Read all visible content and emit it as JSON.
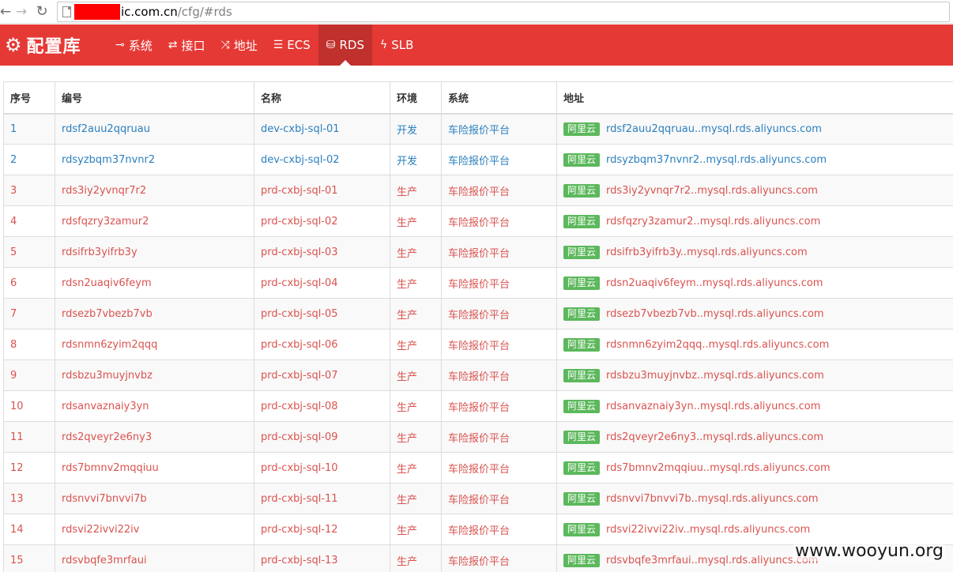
{
  "browser": {
    "url_host": "ic.com.cn",
    "url_path": "/cfg/#rds"
  },
  "brand": {
    "icon": "gears-icon",
    "title": "配置库"
  },
  "nav": [
    {
      "label": "系统",
      "icon": "plug-icon",
      "glyph": "⊸"
    },
    {
      "label": "接口",
      "icon": "exchange-icon",
      "glyph": "⇄"
    },
    {
      "label": "地址",
      "icon": "random-icon",
      "glyph": "⤨"
    },
    {
      "label": "ECS",
      "icon": "list-icon",
      "glyph": "☰"
    },
    {
      "label": "RDS",
      "icon": "database-icon",
      "glyph": "⛁",
      "active": true
    },
    {
      "label": "SLB",
      "icon": "bolt-icon",
      "glyph": "ϟ"
    }
  ],
  "table": {
    "headers": [
      "序号",
      "编号",
      "名称",
      "环境",
      "系统",
      "地址"
    ],
    "badge_label": "阿里云",
    "rows": [
      {
        "index": "1",
        "id": "rdsf2auu2qqruau",
        "name": "dev-cxbj-sql-01",
        "env": "开发",
        "system": "车险报价平台",
        "address": "rdsf2auu2qqruau..mysql.rds.aliyuncs.com",
        "kind": "dev"
      },
      {
        "index": "2",
        "id": "rdsyzbqm37nvnr2",
        "name": "dev-cxbj-sql-02",
        "env": "开发",
        "system": "车险报价平台",
        "address": "rdsyzbqm37nvnr2..mysql.rds.aliyuncs.com",
        "kind": "dev"
      },
      {
        "index": "3",
        "id": "rds3iy2yvnqr7r2",
        "name": "prd-cxbj-sql-01",
        "env": "生产",
        "system": "车险报价平台",
        "address": "rds3iy2yvnqr7r2..mysql.rds.aliyuncs.com",
        "kind": "prd"
      },
      {
        "index": "4",
        "id": "rdsfqzry3zamur2",
        "name": "prd-cxbj-sql-02",
        "env": "生产",
        "system": "车险报价平台",
        "address": "rdsfqzry3zamur2..mysql.rds.aliyuncs.com",
        "kind": "prd"
      },
      {
        "index": "5",
        "id": "rdsifrb3yifrb3y",
        "name": "prd-cxbj-sql-03",
        "env": "生产",
        "system": "车险报价平台",
        "address": "rdsifrb3yifrb3y..mysql.rds.aliyuncs.com",
        "kind": "prd"
      },
      {
        "index": "6",
        "id": "rdsn2uaqiv6feym",
        "name": "prd-cxbj-sql-04",
        "env": "生产",
        "system": "车险报价平台",
        "address": "rdsn2uaqiv6feym..mysql.rds.aliyuncs.com",
        "kind": "prd"
      },
      {
        "index": "7",
        "id": "rdsezb7vbezb7vb",
        "name": "prd-cxbj-sql-05",
        "env": "生产",
        "system": "车险报价平台",
        "address": "rdsezb7vbezb7vb..mysql.rds.aliyuncs.com",
        "kind": "prd"
      },
      {
        "index": "8",
        "id": "rdsnmn6zyim2qqq",
        "name": "prd-cxbj-sql-06",
        "env": "生产",
        "system": "车险报价平台",
        "address": "rdsnmn6zyim2qqq..mysql.rds.aliyuncs.com",
        "kind": "prd"
      },
      {
        "index": "9",
        "id": "rdsbzu3muyjnvbz",
        "name": "prd-cxbj-sql-07",
        "env": "生产",
        "system": "车险报价平台",
        "address": "rdsbzu3muyjnvbz..mysql.rds.aliyuncs.com",
        "kind": "prd"
      },
      {
        "index": "10",
        "id": "rdsanvaznaiy3yn",
        "name": "prd-cxbj-sql-08",
        "env": "生产",
        "system": "车险报价平台",
        "address": "rdsanvaznaiy3yn..mysql.rds.aliyuncs.com",
        "kind": "prd"
      },
      {
        "index": "11",
        "id": "rds2qveyr2e6ny3",
        "name": "prd-cxbj-sql-09",
        "env": "生产",
        "system": "车险报价平台",
        "address": "rds2qveyr2e6ny3..mysql.rds.aliyuncs.com",
        "kind": "prd"
      },
      {
        "index": "12",
        "id": "rds7bmnv2mqqiuu",
        "name": "prd-cxbj-sql-10",
        "env": "生产",
        "system": "车险报价平台",
        "address": "rds7bmnv2mqqiuu..mysql.rds.aliyuncs.com",
        "kind": "prd"
      },
      {
        "index": "13",
        "id": "rdsnvvi7bnvvi7b",
        "name": "prd-cxbj-sql-11",
        "env": "生产",
        "system": "车险报价平台",
        "address": "rdsnvvi7bnvvi7b..mysql.rds.aliyuncs.com",
        "kind": "prd"
      },
      {
        "index": "14",
        "id": "rdsvi22ivvi22iv",
        "name": "prd-cxbj-sql-12",
        "env": "生产",
        "system": "车险报价平台",
        "address": "rdsvi22ivvi22iv..mysql.rds.aliyuncs.com",
        "kind": "prd"
      },
      {
        "index": "15",
        "id": "rdsvbqfe3mrfaui",
        "name": "prd-cxbj-sql-13",
        "env": "生产",
        "system": "车险报价平台",
        "address": "rdsvbqfe3mrfaui..mysql.rds.aliyuncs.com",
        "kind": "prd"
      }
    ]
  },
  "watermark": "www.wooyun.org",
  "colors": {
    "navbar": "#e53935",
    "navbar_active": "#c0302c",
    "dev_text": "#2a7fbf",
    "prd_text": "#d9534f",
    "badge": "#5cb85c"
  }
}
